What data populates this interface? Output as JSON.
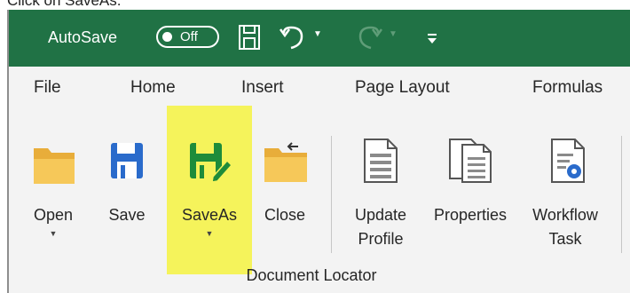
{
  "instruction": "Click on SaveAs.",
  "titlebar": {
    "autosave_label": "AutoSave",
    "toggle_state": "Off"
  },
  "tabs": [
    "File",
    "Home",
    "Insert",
    "Page Layout",
    "Formulas"
  ],
  "ribbon": {
    "buttons": [
      {
        "label": "Open",
        "dropdown": true
      },
      {
        "label": "Save",
        "dropdown": false
      },
      {
        "label": "SaveAs",
        "dropdown": true,
        "highlighted": true
      },
      {
        "label": "Close",
        "dropdown": false
      },
      {
        "label": "Update Profile",
        "dropdown": false
      },
      {
        "label": "Properties",
        "dropdown": false
      },
      {
        "label": "Workflow Task",
        "dropdown": false
      }
    ],
    "group_label": "Document Locator"
  },
  "colors": {
    "titlebar": "#207245",
    "highlight": "#f5f35b",
    "save_blue": "#2a6bcb",
    "saveas_green": "#1e8c3a",
    "folder_yellow": "#f6c859"
  },
  "icons": [
    "floppy-disk-icon",
    "undo-icon",
    "redo-icon",
    "customize-qat-icon",
    "folder-icon",
    "save-icon",
    "saveas-icon",
    "close-folder-icon",
    "document-icon",
    "properties-icon",
    "workflow-icon"
  ]
}
